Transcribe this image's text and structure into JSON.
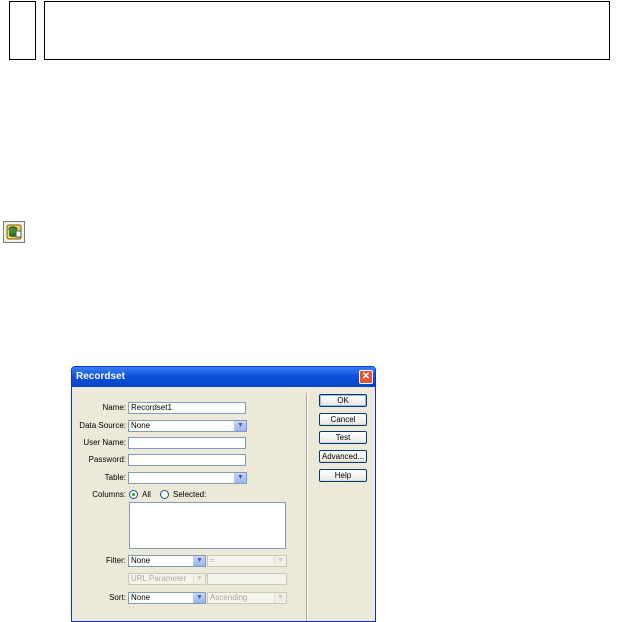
{
  "dialog": {
    "title": "Recordset",
    "close_label": "✕",
    "name_label": "Name:",
    "name_value": "Recordset1",
    "data_source_label": "Data Source:",
    "data_source_value": "None",
    "user_name_label": "User Name:",
    "user_name_value": "",
    "password_label": "Password:",
    "password_value": "",
    "table_label": "Table:",
    "table_value": "",
    "columns_label": "Columns:",
    "columns_all_label": "All",
    "columns_selected_label": "Selected:",
    "filter_label": "Filter:",
    "filter_value": "None",
    "filter_operator": "=",
    "filter_param_type": "URL Parameter",
    "filter_param_value": "",
    "sort_label": "Sort:",
    "sort_value": "None",
    "sort_order": "Ascending"
  },
  "buttons": {
    "ok": "OK",
    "cancel": "Cancel",
    "test": "Test",
    "advanced": "Advanced...",
    "help": "Help"
  },
  "icons": {
    "toolbar": "recordset-icon",
    "dropdown": "chevron-down-icon"
  },
  "colors": {
    "titlebar": "#0a4fd8",
    "dialog_bg": "#ece9d8",
    "field_border": "#7f9db9"
  }
}
